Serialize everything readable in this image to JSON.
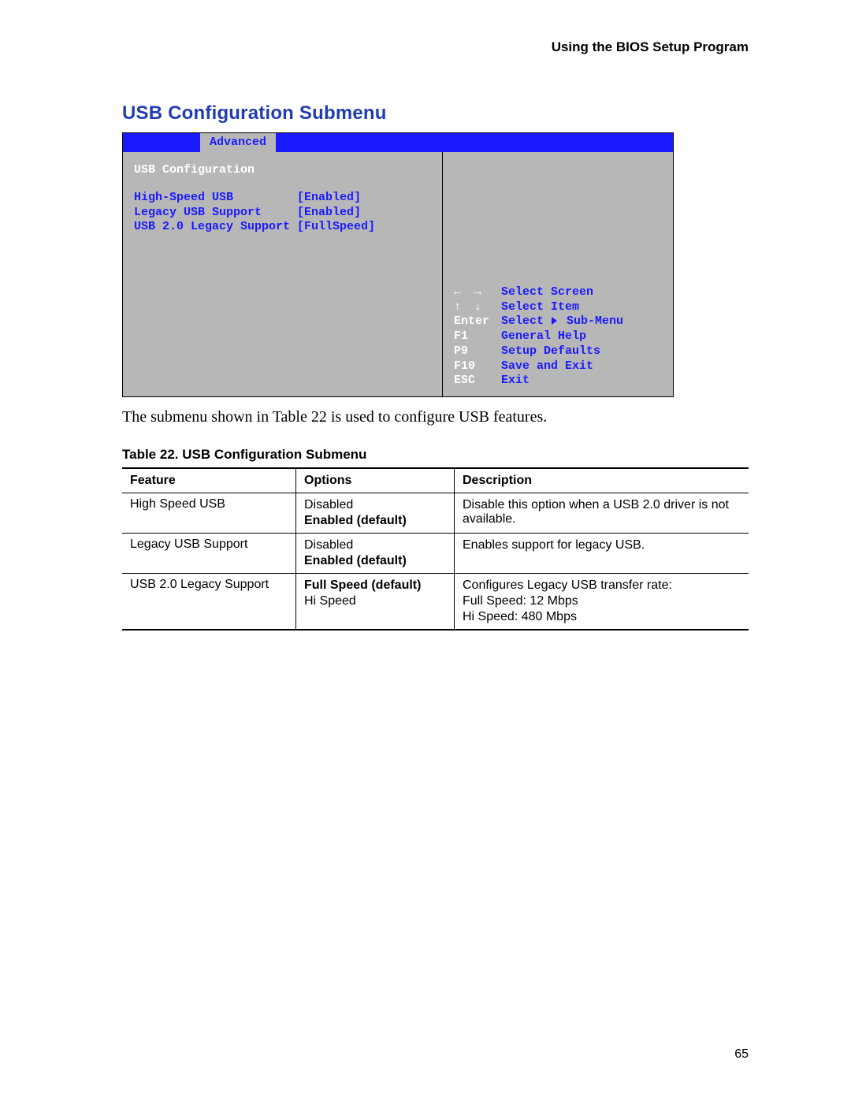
{
  "header": {
    "running_head": "Using the BIOS Setup Program"
  },
  "section": {
    "title": "USB Configuration Submenu"
  },
  "bios": {
    "menu_tab": "Advanced",
    "subtitle": "USB Configuration",
    "rows": [
      {
        "label": "High-Speed USB",
        "pad": "         ",
        "value": "[Enabled]"
      },
      {
        "label": "Legacy USB Support",
        "pad": "     ",
        "value": "[Enabled]"
      },
      {
        "label": "USB 2.0 Legacy Support",
        "pad": " ",
        "value": "[FullSpeed]"
      }
    ],
    "nav_lr": "← →",
    "nav_ud": "↑ ↓",
    "nav": [
      {
        "key_is_arrow": "lr",
        "label": "Select Screen"
      },
      {
        "key_is_arrow": "ud",
        "label": "Select Item"
      },
      {
        "key": "Enter",
        "label_pre": "Select ",
        "triangle": true,
        "label_post": " Sub-Menu"
      },
      {
        "key": "F1",
        "label": "General Help"
      },
      {
        "key": "P9",
        "label": "Setup Defaults"
      },
      {
        "key": "F10",
        "label": "Save and Exit"
      },
      {
        "key": "ESC",
        "label": "Exit"
      }
    ]
  },
  "caption": "The submenu shown in Table 22 is used to configure USB features.",
  "table": {
    "title_prefix": "Table 22.   ",
    "title_name": "USB Configuration Submenu",
    "headers": {
      "feature": "Feature",
      "options": "Options",
      "description": "Description"
    },
    "rows": [
      {
        "feature": "High Speed USB",
        "options": [
          {
            "text": "Disabled",
            "bold": false
          },
          {
            "text": "Enabled (default)",
            "bold": true
          }
        ],
        "description": "Disable this option when a USB 2.0 driver is not available."
      },
      {
        "feature": "Legacy USB Support",
        "options": [
          {
            "text": "Disabled",
            "bold": false
          },
          {
            "text": "Enabled (default)",
            "bold": true
          }
        ],
        "description": "Enables support for legacy USB."
      },
      {
        "feature": "USB 2.0 Legacy Support",
        "options": [
          {
            "text": "Full Speed (default)",
            "bold": true
          },
          {
            "text": "Hi Speed",
            "bold": false
          }
        ],
        "description": "Configures Legacy USB transfer rate:\nFull Speed:  12 Mbps\nHi Speed:  480 Mbps"
      }
    ]
  },
  "page_number": "65"
}
